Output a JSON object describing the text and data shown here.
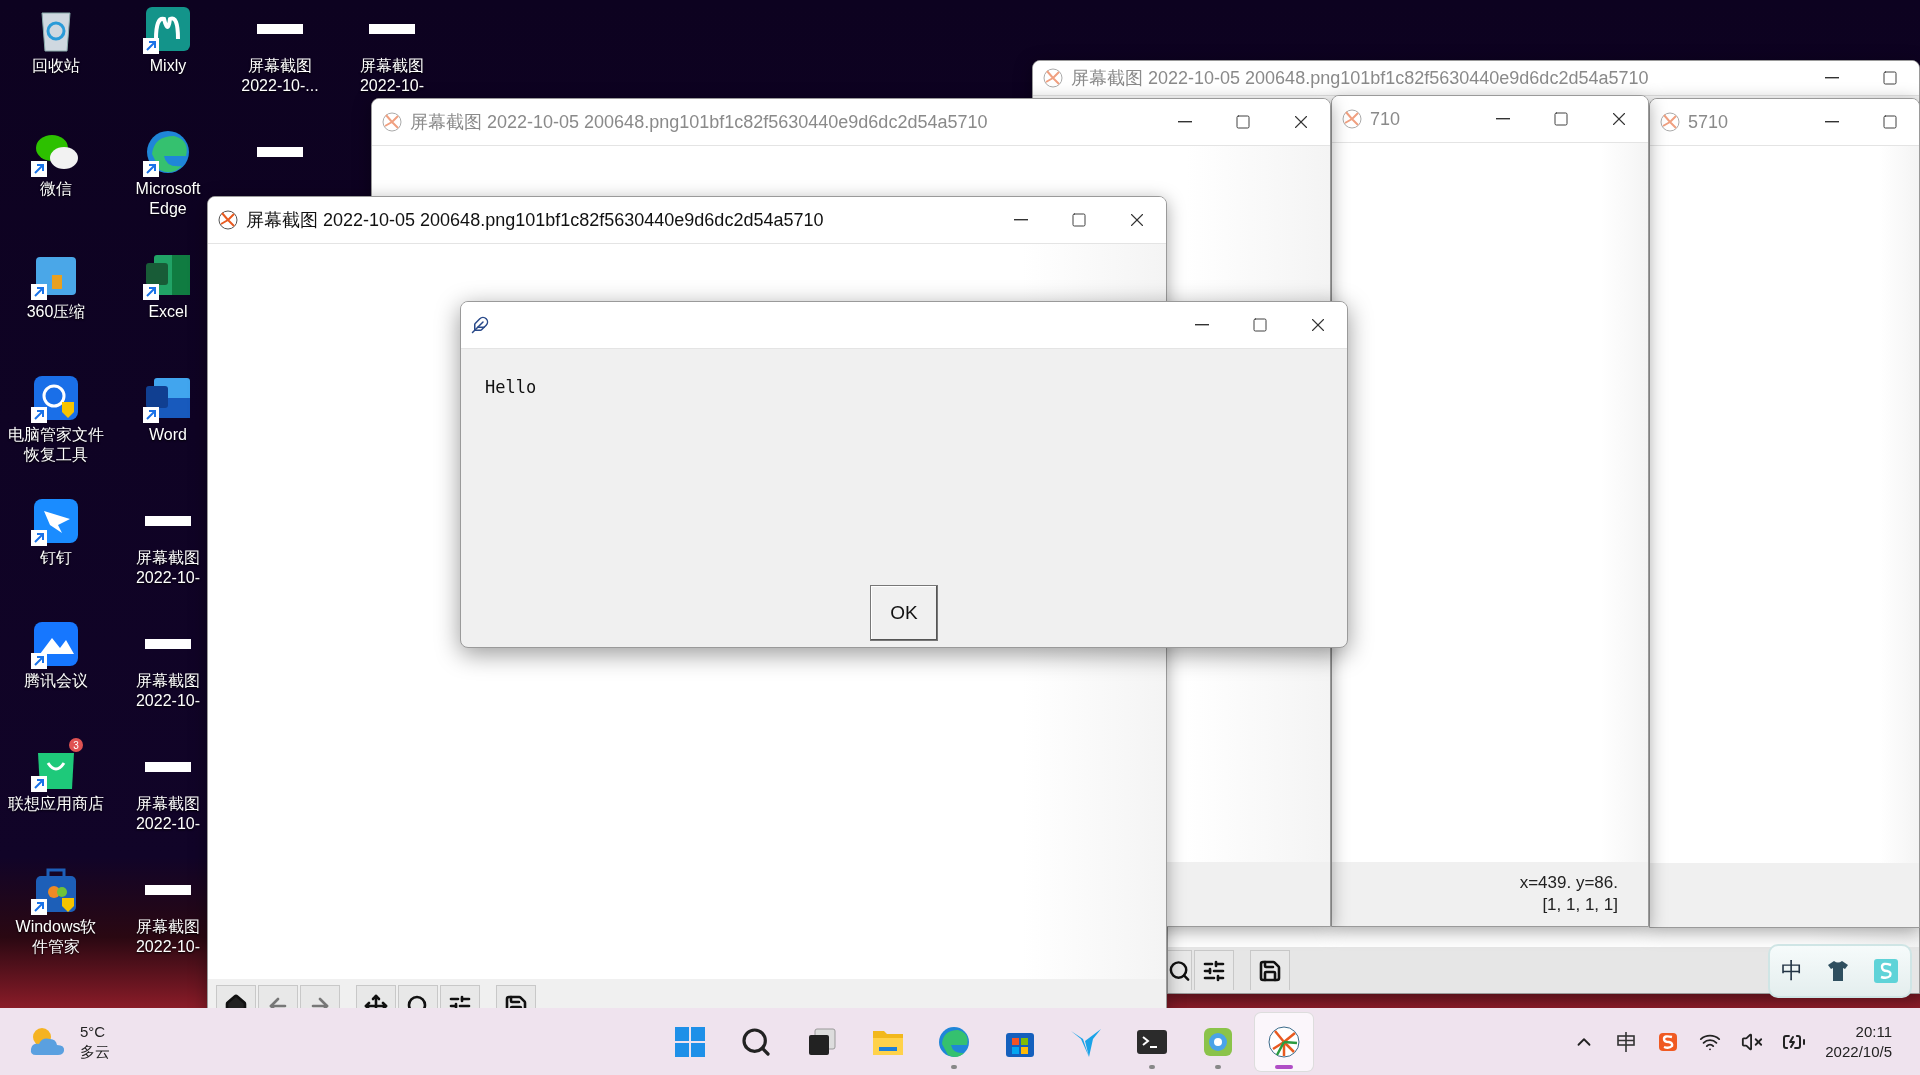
{
  "desktop_columns": [
    [
      {
        "label": [
          "回收站"
        ],
        "kind": "recycle-bin"
      },
      {
        "label": [
          "微信"
        ],
        "kind": "chat"
      },
      {
        "label": [
          "360压缩"
        ],
        "kind": "zip"
      },
      {
        "label": [
          "电脑管家文件",
          "恢复工具"
        ],
        "kind": "shield"
      },
      {
        "label": [
          "钉钉"
        ],
        "kind": "wing"
      },
      {
        "label": [
          "腾讯会议"
        ],
        "kind": "meeting"
      },
      {
        "label": [
          "联想应用商店"
        ],
        "kind": "store",
        "badge": "3"
      },
      {
        "label": [
          "Windows软",
          "件管家"
        ],
        "kind": "toolbox"
      }
    ],
    [
      {
        "label": [
          "Mixly"
        ],
        "kind": "mixly"
      },
      {
        "label": [
          "Microsoft",
          "Edge"
        ],
        "kind": "edge"
      },
      {
        "label": [
          "Excel"
        ],
        "kind": "excel"
      },
      {
        "label": [
          "Word"
        ],
        "kind": "word"
      },
      {
        "label": [
          "屏幕截图",
          "2022-10-"
        ],
        "kind": "image-file"
      },
      {
        "label": [
          "屏幕截图",
          "2022-10-"
        ],
        "kind": "image-file"
      },
      {
        "label": [
          "屏幕截图",
          "2022-10-"
        ],
        "kind": "image-file"
      },
      {
        "label": [
          "屏幕截图",
          "2022-10-"
        ],
        "kind": "image-file"
      }
    ],
    [
      {
        "label": [
          "屏幕截图",
          "2022-10-..."
        ],
        "kind": "image-file"
      },
      {
        "kind": "image-file"
      }
    ],
    [
      {
        "label": [
          "屏幕截图",
          "2022-10-"
        ],
        "kind": "image-file"
      }
    ]
  ],
  "windows": [
    {
      "title": "屏幕截图 2022-10-05 200648.png101bf1c82f5630440e9d6dc2d54a5710",
      "active": false
    },
    {
      "title": "屏幕截图 2022-10-05 200648.png101bf1c82f5630440e9d6dc2d54a5710",
      "active": false
    },
    {
      "title": "710",
      "active": false,
      "status": [
        "x=439. y=86.",
        "[1, 1, 1, 1]"
      ]
    },
    {
      "title": "5710",
      "active": false
    },
    {
      "title": "屏幕截图 2022-10-05 200648.png101bf1c82f5630440e9d6dc2d54a5710",
      "active": true
    }
  ],
  "dialog": {
    "message": "Hello",
    "button": "OK"
  },
  "ime_bar": {
    "label": "中"
  },
  "taskbar": {
    "weather": {
      "temperature": "5°C",
      "condition": "多云"
    },
    "apps": [
      {
        "kind": "start",
        "running": false,
        "selected": false
      },
      {
        "kind": "search",
        "running": false,
        "selected": false
      },
      {
        "kind": "task-view",
        "running": false,
        "selected": false
      },
      {
        "kind": "folder",
        "running": false,
        "selected": false
      },
      {
        "kind": "edge",
        "running": true,
        "selected": false
      },
      {
        "kind": "store",
        "running": false,
        "selected": false
      },
      {
        "kind": "vee",
        "running": false,
        "selected": false
      },
      {
        "kind": "terminal",
        "running": true,
        "selected": false
      },
      {
        "kind": "robot",
        "running": true,
        "selected": false
      },
      {
        "kind": "feather",
        "running": true,
        "selected": true
      }
    ],
    "tray": [
      {
        "kind": "chevron"
      },
      {
        "kind": "ime"
      },
      {
        "kind": "sogou"
      },
      {
        "kind": "wifi"
      },
      {
        "kind": "muted"
      },
      {
        "kind": "battery"
      }
    ],
    "time": "20:11",
    "date": "2022/10/5"
  }
}
